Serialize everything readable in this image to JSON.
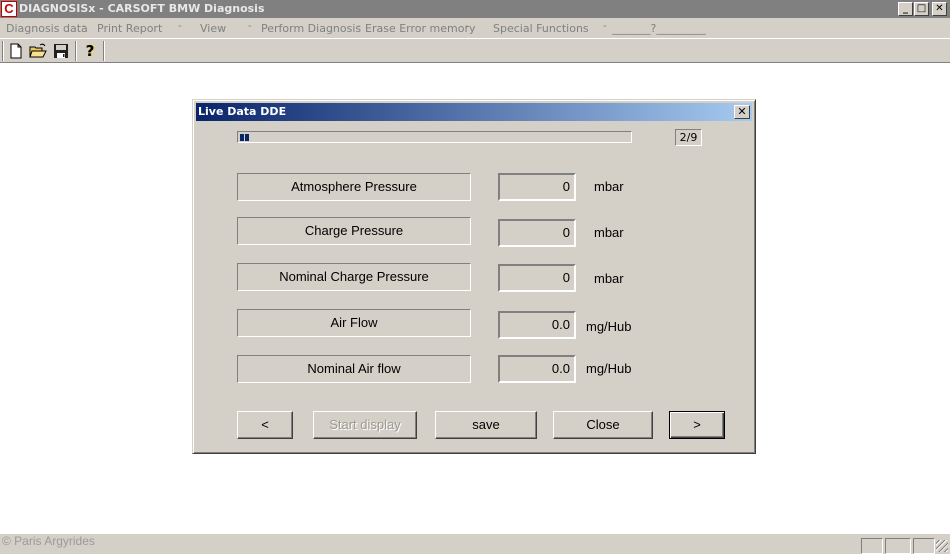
{
  "app": {
    "icon_letter": "C",
    "title": "DIAGNOSISx - CARSOFT BMW Diagnosis",
    "win_min": "_",
    "win_max": "□",
    "win_close": "✕"
  },
  "menu": {
    "items": [
      "Diagnosis data",
      "Print Report",
      "View",
      "Perform Diagnosis",
      "Erase Error memory",
      "Special Functions",
      "_______?_________"
    ],
    "separator": "-"
  },
  "toolbar": {
    "icons": [
      "new-document-icon",
      "open-folder-icon",
      "save-disk-icon",
      "help-question-icon"
    ],
    "help_glyph": "?"
  },
  "dialog": {
    "title": "Live Data DDE",
    "close": "✕",
    "progress": {
      "value": 2,
      "max": 9
    },
    "page_indicator": "2/9",
    "rows": [
      {
        "label": "Atmosphere Pressure",
        "value": "0",
        "unit": "mbar"
      },
      {
        "label": "Charge Pressure",
        "value": "0",
        "unit": "mbar"
      },
      {
        "label": "Nominal Charge Pressure",
        "value": "0",
        "unit": "mbar"
      },
      {
        "label": "Air Flow",
        "value": "0.0",
        "unit": "mg/Hub"
      },
      {
        "label": "Nominal Air flow",
        "value": "0.0",
        "unit": "mg/Hub"
      }
    ],
    "buttons": {
      "prev": "<",
      "start_display": "Start display",
      "save": "save",
      "close": "Close",
      "next": ">"
    }
  },
  "status": {
    "watermark": "© Paris Argyrides"
  },
  "colors": {
    "face": "#d4d0c8",
    "title_inactive": "#808080",
    "dialog_title_start": "#0a246a",
    "dialog_title_end": "#a6caf0"
  }
}
